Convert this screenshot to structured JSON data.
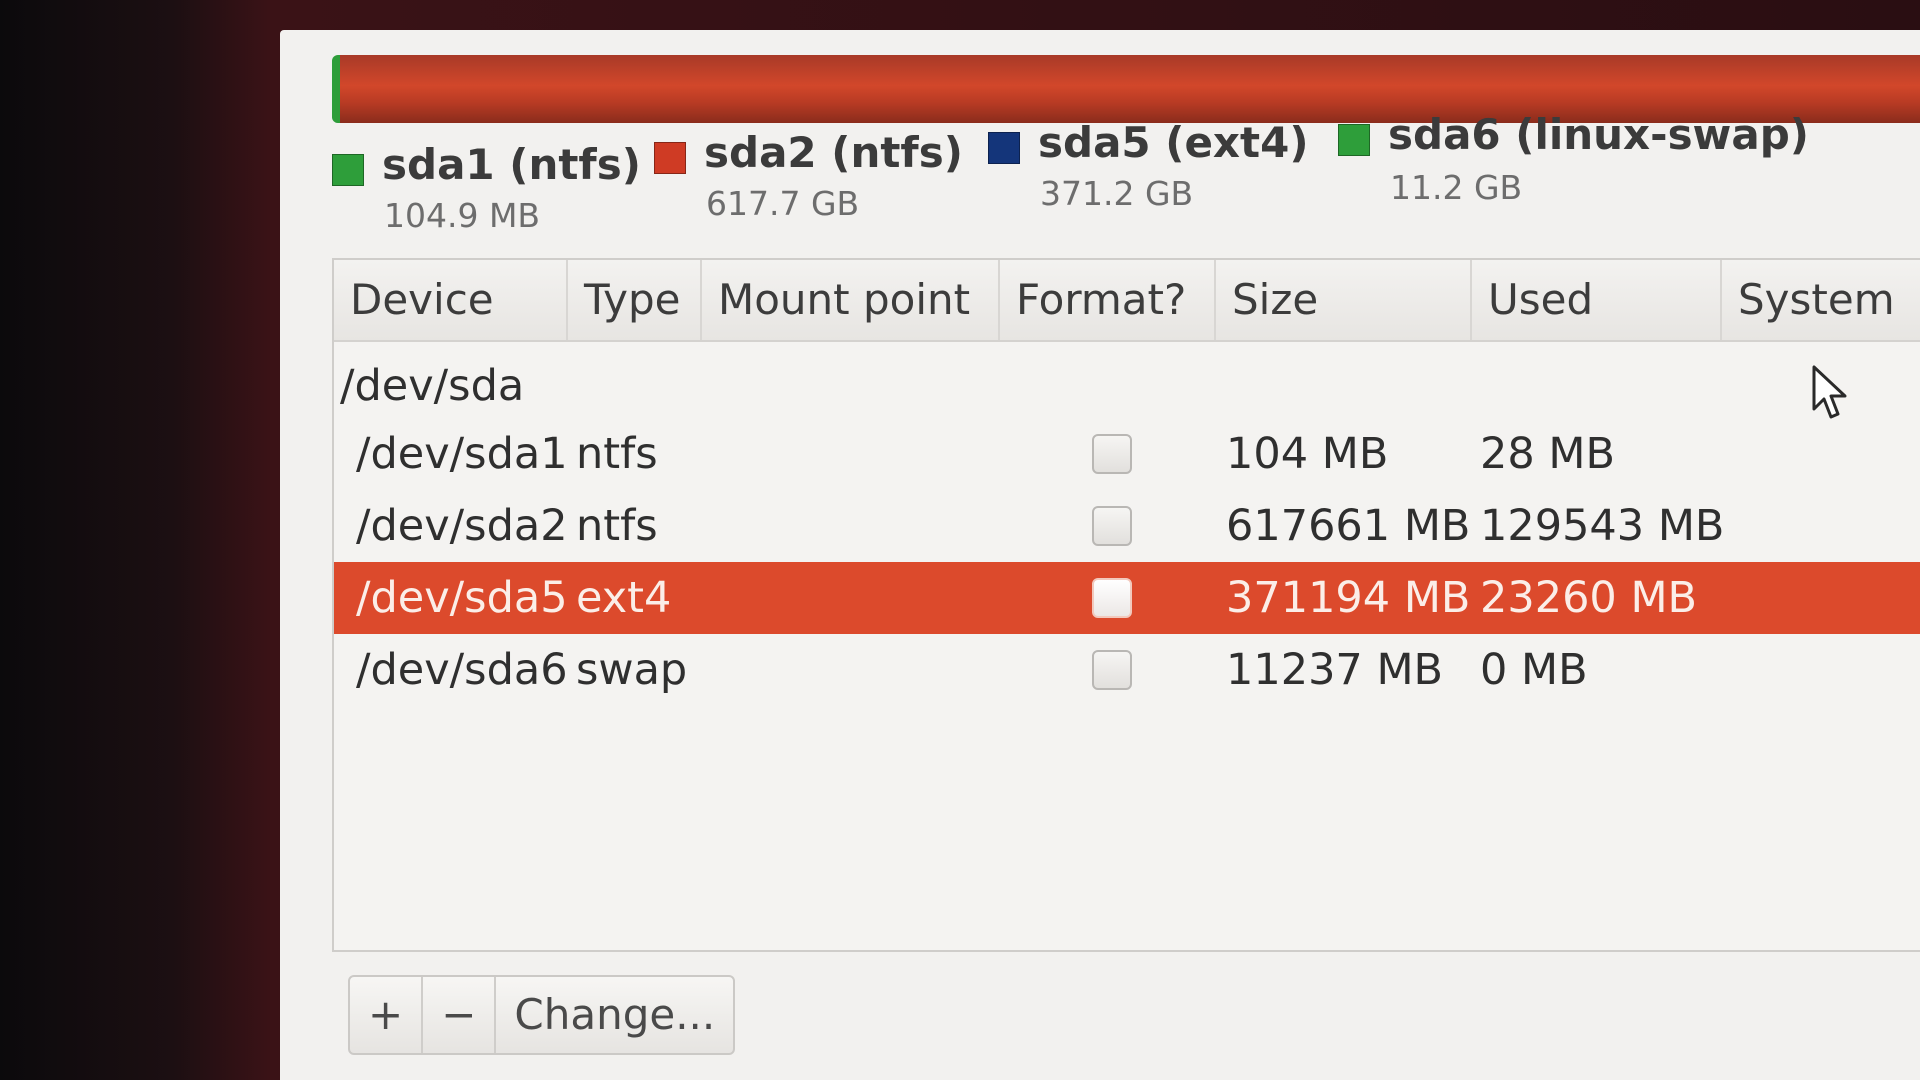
{
  "partition_bar": {
    "segments": [
      {
        "name": "sda1",
        "color": "#2e9e3a"
      },
      {
        "name": "sda2",
        "color": "#cf3b24"
      }
    ]
  },
  "legend": [
    {
      "name": "sda1 (ntfs)",
      "size": "104.9 MB",
      "color": "#2e9e3a"
    },
    {
      "name": "sda2 (ntfs)",
      "size": "617.7 GB",
      "color": "#cf3b24"
    },
    {
      "name": "sda5 (ext4)",
      "size": "371.2 GB",
      "color": "#14357a"
    },
    {
      "name": "sda6 (linux-swap)",
      "size": "11.2 GB",
      "color": "#2e9e3a"
    }
  ],
  "table": {
    "columns": [
      "Device",
      "Type",
      "Mount point",
      "Format?",
      "Size",
      "Used",
      "System"
    ],
    "disk": "/dev/sda",
    "rows": [
      {
        "device": "/dev/sda1",
        "type": "ntfs",
        "mount": "",
        "format": false,
        "size": "104 MB",
        "used": "28 MB",
        "system": "",
        "selected": false
      },
      {
        "device": "/dev/sda2",
        "type": "ntfs",
        "mount": "",
        "format": false,
        "size": "617661 MB",
        "used": "129543 MB",
        "system": "",
        "selected": false
      },
      {
        "device": "/dev/sda5",
        "type": "ext4",
        "mount": "",
        "format": false,
        "size": "371194 MB",
        "used": "23260 MB",
        "system": "",
        "selected": true
      },
      {
        "device": "/dev/sda6",
        "type": "swap",
        "mount": "",
        "format": false,
        "size": "11237 MB",
        "used": "0 MB",
        "system": "",
        "selected": false
      }
    ]
  },
  "toolbar": {
    "add_label": "+",
    "remove_label": "−",
    "change_label": "Change..."
  },
  "colors": {
    "selection": "#dc4a2c",
    "accent_bar": "#d2472a"
  }
}
